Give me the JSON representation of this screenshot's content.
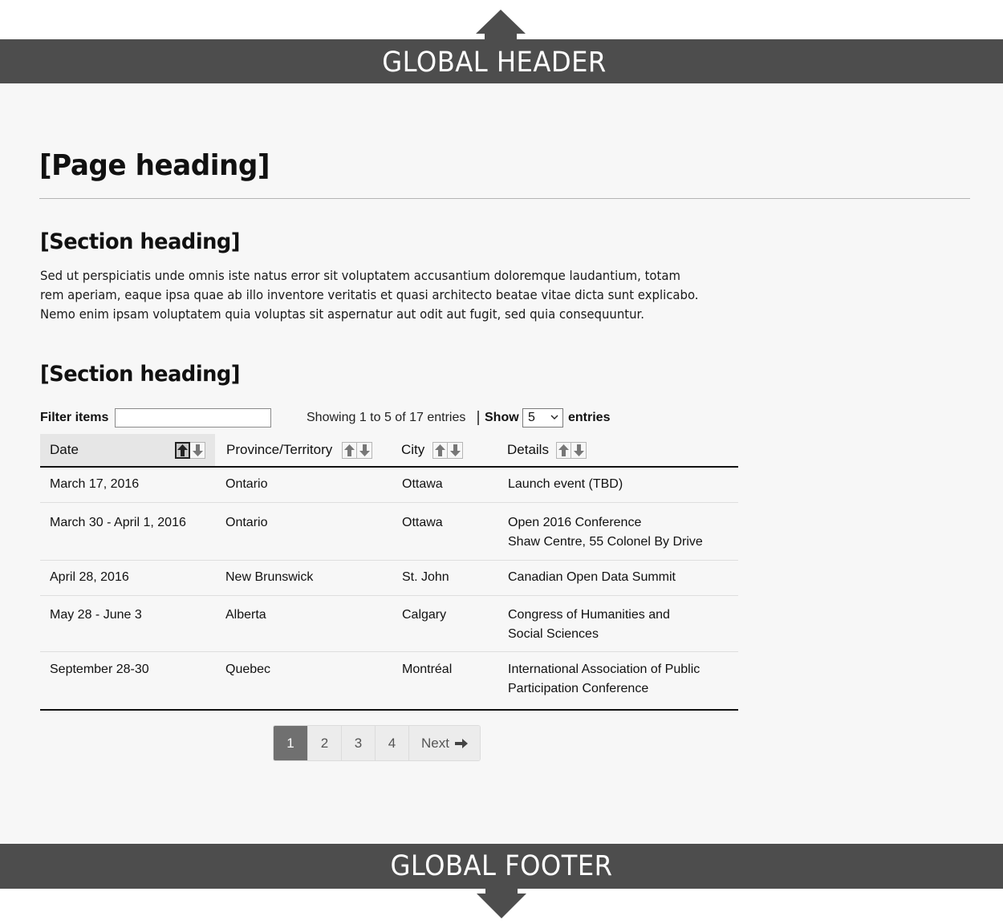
{
  "global_header": {
    "label": "GLOBAL HEADER"
  },
  "global_footer": {
    "label": "GLOBAL FOOTER"
  },
  "page_heading": "[Page heading]",
  "sections": [
    {
      "heading": "[Section heading]",
      "body_lines": [
        "Sed ut perspiciatis unde omnis iste natus error sit voluptatem accusantium doloremque laudantium, totam",
        "rem aperiam, eaque ipsa quae ab illo inventore veritatis et quasi architecto beatae vitae dicta sunt explicabo.",
        "Nemo enim ipsam voluptatem quia voluptas sit aspernatur aut odit aut fugit, sed quia consequuntur."
      ]
    },
    {
      "heading": "[Section heading]"
    }
  ],
  "table_controls": {
    "filter_label": "Filter items",
    "filter_value": "",
    "showing_text": "Showing 1 to 5 of 17 entries",
    "show_label": "Show",
    "page_size": "5",
    "entries_label": "entries"
  },
  "table": {
    "columns": [
      {
        "label": "Date",
        "sorted": "ascending"
      },
      {
        "label": "Province/Territory",
        "sorted": "none"
      },
      {
        "label": "City",
        "sorted": "none"
      },
      {
        "label": "Details",
        "sorted": "none"
      }
    ],
    "rows": [
      {
        "date": "March 17, 2016",
        "province": "Ontario",
        "city": "Ottawa",
        "details": [
          "Launch event (TBD)"
        ]
      },
      {
        "date": "March 30 - April 1, 2016",
        "province": "Ontario",
        "city": "Ottawa",
        "details": [
          "Open 2016 Conference",
          "Shaw Centre, 55 Colonel By Drive"
        ]
      },
      {
        "date": "April 28, 2016",
        "province": "New Brunswick",
        "city": "St. John",
        "details": [
          "Canadian Open Data Summit"
        ]
      },
      {
        "date": "May 28 - June 3",
        "province": "Alberta",
        "city": "Calgary",
        "details": [
          "Congress of Humanities and",
          "Social Sciences"
        ]
      },
      {
        "date": "September 28-30",
        "province": "Quebec",
        "city": "Montréal",
        "details": [
          "International Association of Public",
          "Participation Conference"
        ]
      }
    ]
  },
  "pagination": {
    "pages": [
      "1",
      "2",
      "3",
      "4"
    ],
    "current": "1",
    "next_label": "Next",
    "next_icon": "arrow-right-icon"
  },
  "colors": {
    "header_bg": "#4d4d4d",
    "page_bg": "#f7f7f7",
    "active_page": "#707070"
  }
}
